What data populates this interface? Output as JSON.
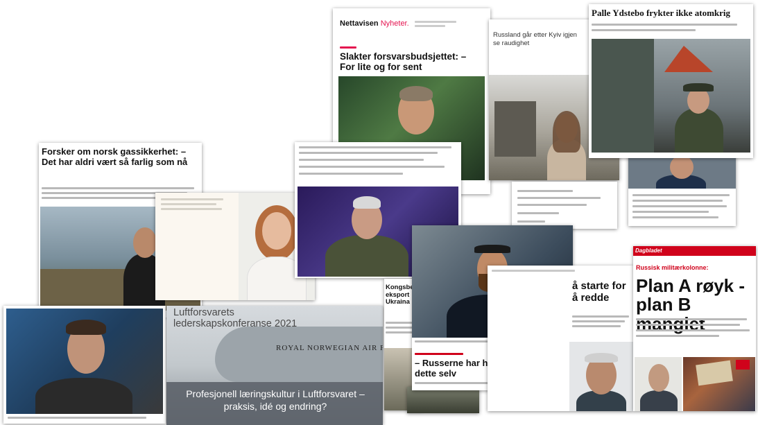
{
  "clippings": {
    "nettavisen": {
      "brand_a": "Nettavisen",
      "brand_b": "Nyheter.",
      "headline": "Slakter forsvarsbudsjettet: – For lite og for sent"
    },
    "russland": {
      "headline_a": "Russland går etter Kyiv igjen",
      "headline_b": "se raudighet"
    },
    "palle": {
      "headline": "Palle Ydstebo frykter ikke atomkrig"
    },
    "gass": {
      "headline": "Forsker om norsk gassikkerhet: – Det har aldri vært så farlig som nå"
    },
    "luftforsvaret": {
      "conference_title": "Luftforsvarets lederskapskonferanse 2021",
      "aircraft_text": "ROYAL NORWEGIAN AIR FORCE",
      "caption": "Profesjonell læringskultur i Luftforsvaret – praksis, idé og endring?"
    },
    "russerne": {
      "headline": "– Russerne har helt bevisst gjort dette selv"
    },
    "kongsberg": {
      "headline": "Kongsberg eksport Ukraina"
    },
    "starte": {
      "headline": "å starte for å redde"
    },
    "plan": {
      "masthead": "Dagbladet",
      "kicker": "Russisk militærkolonne:",
      "headline": "Plan A røyk - plan B manglet"
    }
  },
  "colors": {
    "nettavisen_red": "#e4134f",
    "dagbladet_red": "#d0021b",
    "tv_purple": "#3a2a6a",
    "uniform_green": "#4a5238"
  }
}
